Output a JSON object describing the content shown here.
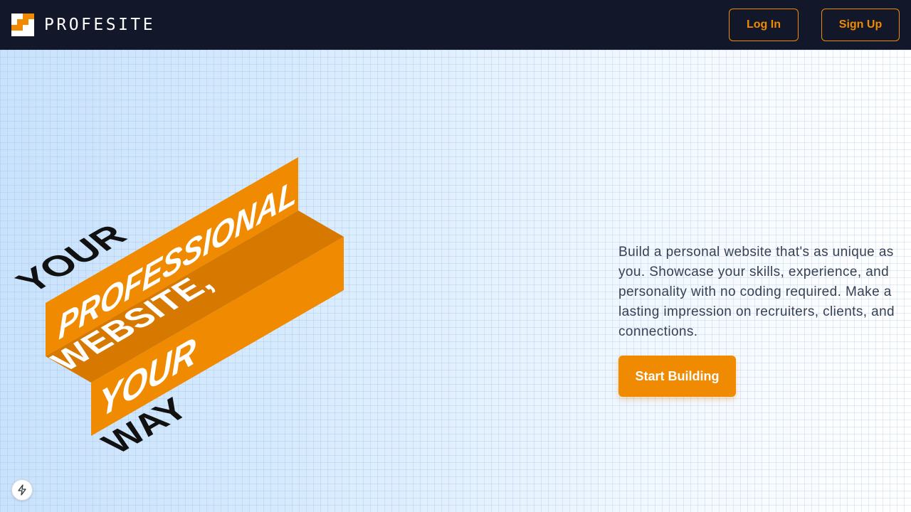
{
  "nav": {
    "brand": "PROFESITE",
    "login_label": "Log In",
    "signup_label": "Sign Up",
    "logo_icon": "checker-logo-icon"
  },
  "hero": {
    "headline": {
      "line1": "YOUR",
      "line2": "PROFESSIONAL",
      "line3": "WEBSITE,",
      "line4": "YOUR",
      "line5": "WAY"
    },
    "description": "Build a personal website that's as unique as you. Showcase your skills, experience, and personality with no coding required. Make a lasting impression on recruiters, clients, and connections.",
    "cta_label": "Start Building"
  },
  "floating": {
    "icon": "lightning-bolt-icon"
  },
  "colors": {
    "accent": "#f08a00",
    "accent_dark": "#d77800",
    "navbar_bg": "#121829",
    "text_body": "#374151"
  }
}
